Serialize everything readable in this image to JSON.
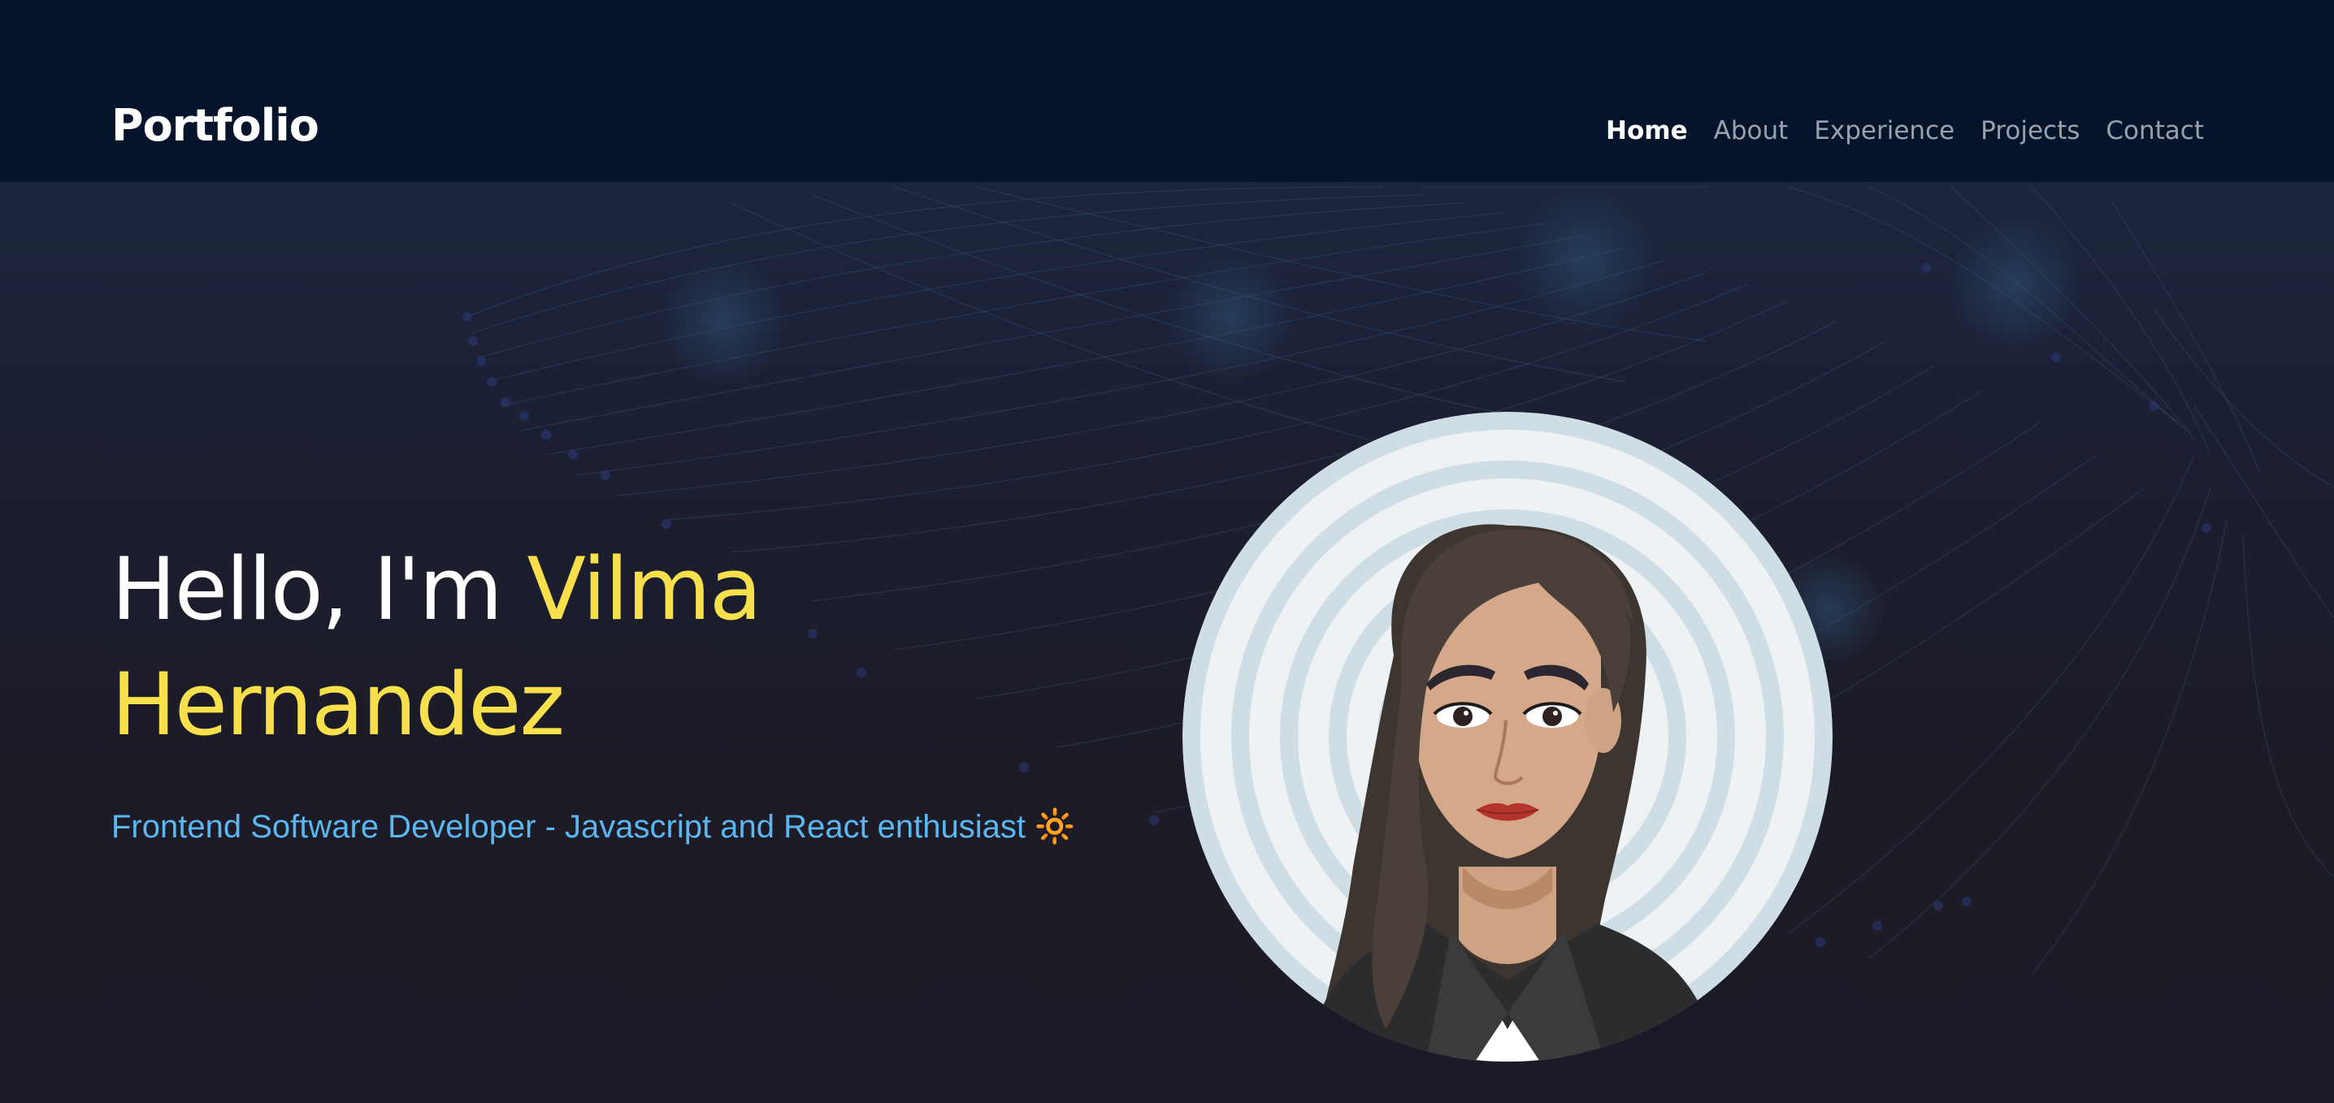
{
  "navbar": {
    "brand": "Portfolio",
    "links": [
      {
        "label": "Home",
        "active": true
      },
      {
        "label": "About",
        "active": false
      },
      {
        "label": "Experience",
        "active": false
      },
      {
        "label": "Projects",
        "active": false
      },
      {
        "label": "Contact",
        "active": false
      }
    ]
  },
  "hero": {
    "greeting": "Hello, I'm",
    "name_first": "Vilma",
    "name_last": "Hernandez",
    "subtitle": "Frontend Software Developer - Javascript and React enthusiast 🔆"
  },
  "colors": {
    "navbar_bg": "#06142b",
    "name_accent": "#f7e04b",
    "subtitle": "#5ab7f0",
    "nav_inactive": "#9aa1ad",
    "nav_active": "#ffffff"
  },
  "icons": {
    "avatar": "cartoon-avatar-woman",
    "background": "network-lines-background"
  }
}
